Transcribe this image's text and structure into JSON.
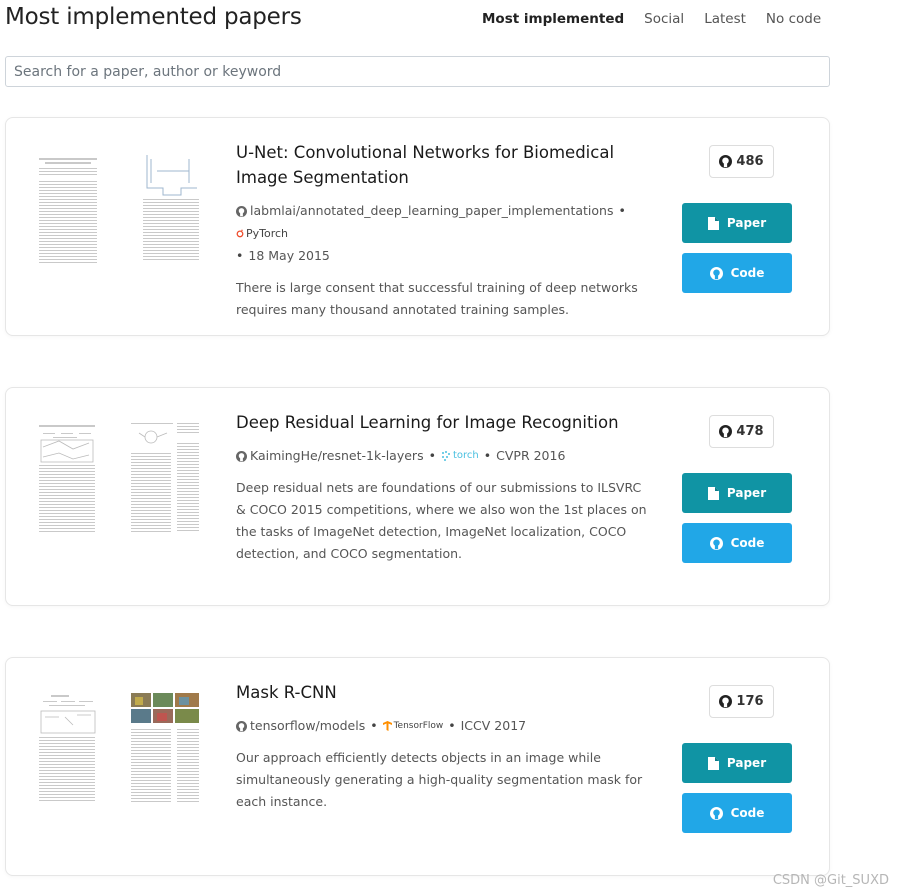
{
  "header": {
    "title": "Most implemented papers",
    "tabs": [
      {
        "label": "Most implemented",
        "active": true
      },
      {
        "label": "Social",
        "active": false
      },
      {
        "label": "Latest",
        "active": false
      },
      {
        "label": "No code",
        "active": false
      }
    ]
  },
  "search": {
    "placeholder": "Search for a paper, author or keyword"
  },
  "colors": {
    "paper_button": "#1094a4",
    "code_button": "#21a7e7",
    "pytorch": "#ee4c2c",
    "tensorflow": "#ff8f00"
  },
  "papers": [
    {
      "title": "U-Net: Convolutional Networks for Biomedical Image Segmentation",
      "repo": "labmlai/annotated_deep_learning_paper_implementations",
      "framework": "PyTorch",
      "framework_icon": "pytorch-icon",
      "date": "18 May 2015",
      "abstract": "There is large consent that successful training of deep networks requires many thousand annotated training samples.",
      "stars": "486",
      "paper_label": "Paper",
      "code_label": "Code"
    },
    {
      "title": "Deep Residual Learning for Image Recognition",
      "repo": "KaimingHe/resnet-1k-layers",
      "framework": "torch",
      "framework_icon": "torch-icon",
      "date": "CVPR 2016",
      "abstract": "Deep residual nets are foundations of our submissions to ILSVRC & COCO 2015 competitions, where we also won the 1st places on the tasks of ImageNet detection, ImageNet localization, COCO detection, and COCO segmentation.",
      "stars": "478",
      "paper_label": "Paper",
      "code_label": "Code"
    },
    {
      "title": "Mask R-CNN",
      "repo": "tensorflow/models",
      "framework": "TensorFlow",
      "framework_icon": "tensorflow-icon",
      "date": "ICCV 2017",
      "abstract": "Our approach efficiently detects objects in an image while simultaneously generating a high-quality segmentation mask for each instance.",
      "stars": "176",
      "paper_label": "Paper",
      "code_label": "Code"
    }
  ],
  "watermark": "CSDN @Git_SUXD"
}
